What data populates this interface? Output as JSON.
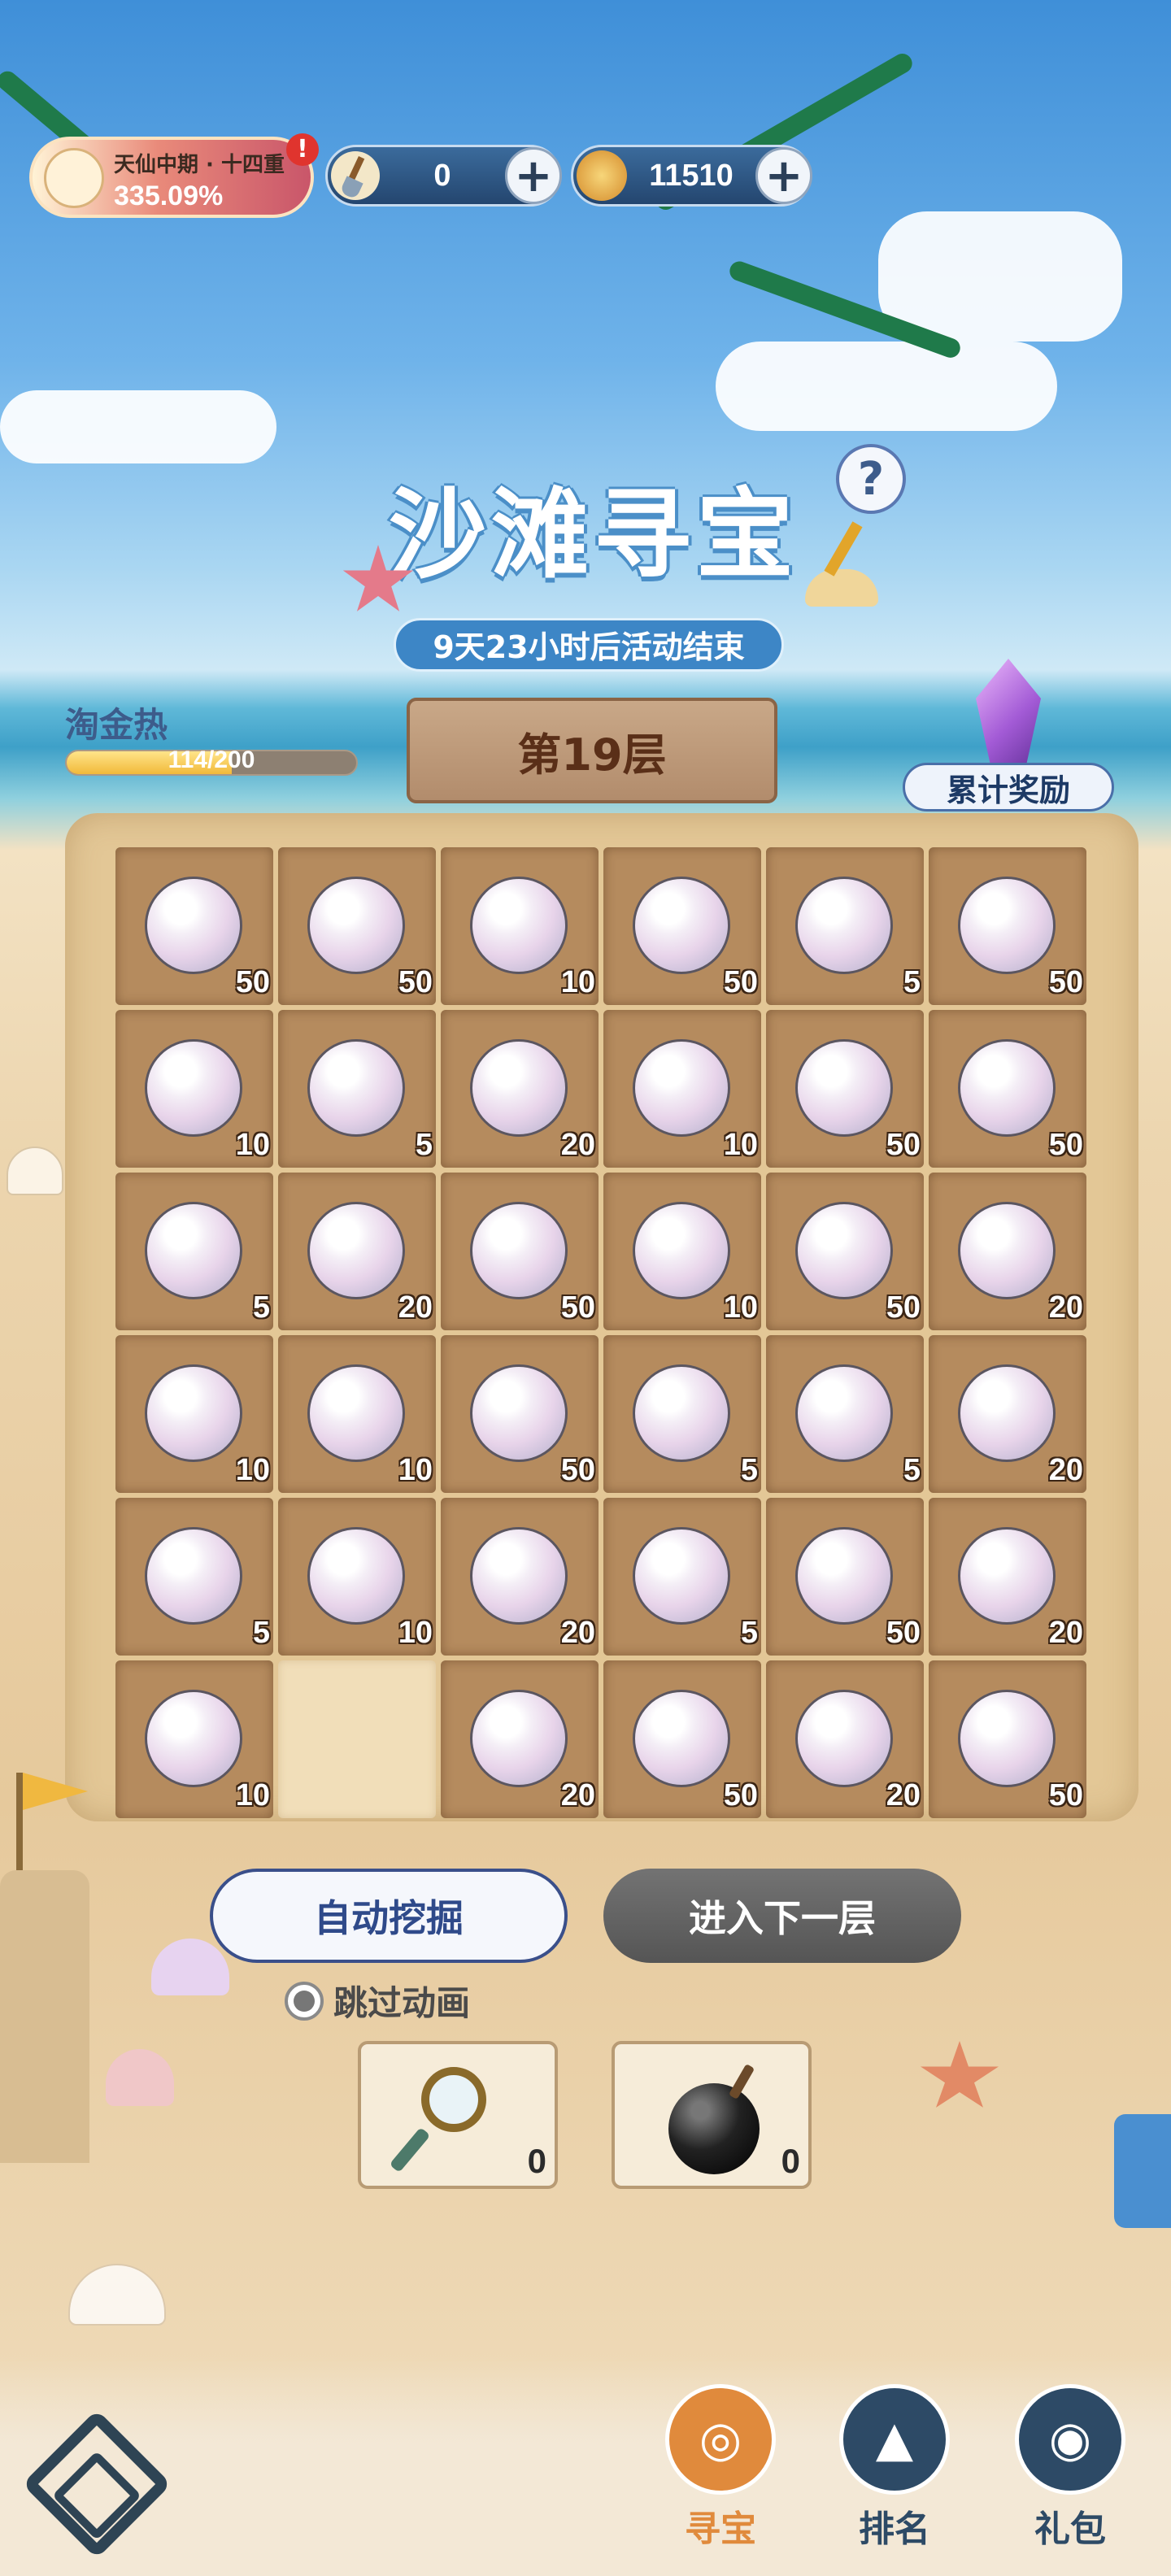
{
  "top_bar": {
    "rank": {
      "name": "天仙中期 · 十四重",
      "percent": "335.09%"
    },
    "shovel": {
      "value": "0",
      "plus": "+"
    },
    "currency": {
      "value": "11510",
      "plus": "+"
    }
  },
  "event": {
    "title": "沙滩寻宝",
    "timer": "9天23小时后活动结束",
    "help": "?"
  },
  "level": {
    "label": "第19层"
  },
  "heat": {
    "label": "淘金热",
    "progress_text": "114/200",
    "progress": 0.57
  },
  "reward": {
    "label": "累计奖励"
  },
  "board": {
    "rows": [
      [
        "50",
        "50",
        "10",
        "50",
        "5",
        "50"
      ],
      [
        "10",
        "5",
        "20",
        "10",
        "50",
        "50"
      ],
      [
        "5",
        "20",
        "50",
        "10",
        "50",
        "20"
      ],
      [
        "10",
        "10",
        "50",
        "5",
        "5",
        "20"
      ],
      [
        "5",
        "10",
        "20",
        "5",
        "50",
        "20"
      ],
      [
        "10",
        null,
        "20",
        "50",
        "20",
        "50"
      ]
    ]
  },
  "actions": {
    "auto_dig": "自动挖掘",
    "next_layer": "进入下一层",
    "skip_animation": "跳过动画"
  },
  "tools": [
    {
      "icon": "magnifier-icon",
      "count": "0"
    },
    {
      "icon": "bomb-icon",
      "count": "0"
    }
  ],
  "nav": [
    {
      "label": "寻宝",
      "icon": "compass-icon",
      "active": true,
      "color": "#e08a3c"
    },
    {
      "label": "排名",
      "icon": "ranking-icon",
      "active": false,
      "color": "#2d4a66"
    },
    {
      "label": "礼包",
      "icon": "gift-bag-icon",
      "active": false,
      "color": "#2d4a66"
    }
  ],
  "colors": {
    "accent": "#e08a3c",
    "navy": "#2d4a66",
    "board": "#b58b5e"
  }
}
